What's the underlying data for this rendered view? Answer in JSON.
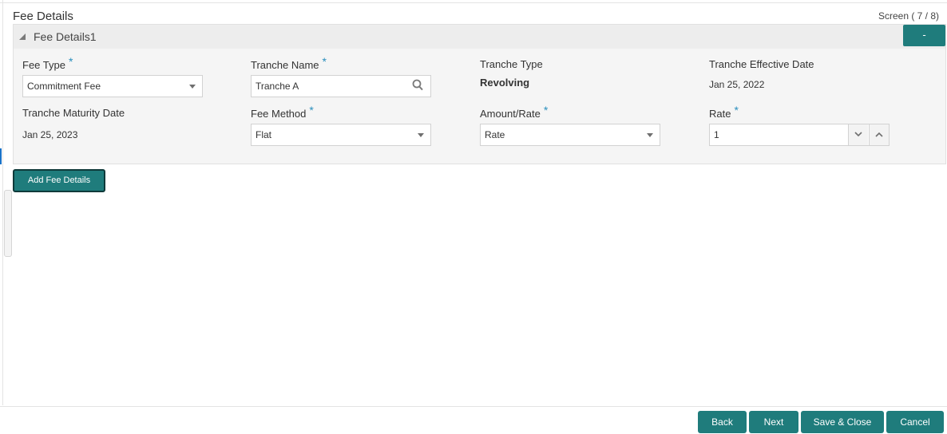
{
  "page": {
    "title": "Fee Details",
    "screen_counter": "Screen ( 7 / 8)"
  },
  "panel": {
    "title": "Fee Details1",
    "remove_label": "-",
    "fields": {
      "fee_type": {
        "label": "Fee Type",
        "required": "*",
        "value": "Commitment Fee"
      },
      "tranche_name": {
        "label": "Tranche Name",
        "required": "*",
        "value": "Tranche A"
      },
      "tranche_type": {
        "label": "Tranche Type",
        "value": "Revolving"
      },
      "tranche_effective_date": {
        "label": "Tranche Effective Date",
        "value": "Jan 25, 2022"
      },
      "tranche_maturity_date": {
        "label": "Tranche Maturity Date",
        "value": "Jan 25, 2023"
      },
      "fee_method": {
        "label": "Fee Method",
        "required": "*",
        "value": "Flat"
      },
      "amount_rate": {
        "label": "Amount/Rate",
        "required": "*",
        "value": "Rate"
      },
      "rate": {
        "label": "Rate",
        "required": "*",
        "value": "1"
      }
    }
  },
  "actions": {
    "add_fee_details": "Add Fee Details"
  },
  "footer": {
    "back": "Back",
    "next": "Next",
    "save_close": "Save & Close",
    "cancel": "Cancel"
  },
  "colors": {
    "accent": "#1f7c7c",
    "required": "#2a8fbd"
  },
  "icons": {
    "collapse": "collapse-triangle-icon",
    "search": "search-icon",
    "dropdown": "chevron-down-icon",
    "stepper_up": "chevron-up-icon"
  }
}
